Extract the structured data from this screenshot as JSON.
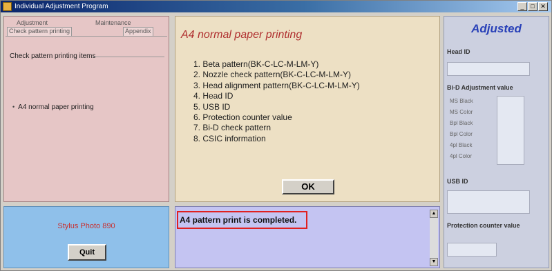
{
  "window": {
    "title": "Individual Adjustment Program",
    "buttons": {
      "minimize": "_",
      "maximize": "□",
      "close": "✕"
    }
  },
  "tabs": {
    "row1": [
      "Adjustment",
      "Maintenance"
    ],
    "row2": [
      "Check pattern printing",
      "Appendix"
    ]
  },
  "left_panel": {
    "section_label": "Check pattern printing items",
    "radio_mark": "•",
    "radio_item": "A4 normal paper printing"
  },
  "device": {
    "model": "Stylus Photo 890",
    "quit_label": "Quit"
  },
  "center_panel": {
    "title": "A4 normal paper printing",
    "items": [
      "1. Beta pattern(BK-C-LC-M-LM-Y)",
      "2. Nozzle check pattern(BK-C-LC-M-LM-Y)",
      "3. Head alignment pattern(BK-C-LC-M-LM-Y)",
      "4. Head ID",
      "5. USB ID",
      "6. Protection counter value",
      "7. Bi-D check pattern",
      "8. CSIC information"
    ],
    "ok_label": "OK"
  },
  "status": {
    "message": "A4 pattern print is completed.",
    "scroll_up": "▲",
    "scroll_down": "▼"
  },
  "right_panel": {
    "title": "Adjusted",
    "head_id_label": "Head ID",
    "bid_label": "Bi-D Adjustment value",
    "bid_fields": [
      "MS Black",
      "MS Color",
      "Bpl Black",
      "Bpl Color",
      "4pl Black",
      "4pl Color"
    ],
    "usb_id_label": "USB ID",
    "protection_label": "Protection counter value"
  },
  "colors": {
    "accent_red": "#b03030",
    "adjusted_blue": "#2840b8",
    "highlight_border": "#e02020"
  }
}
